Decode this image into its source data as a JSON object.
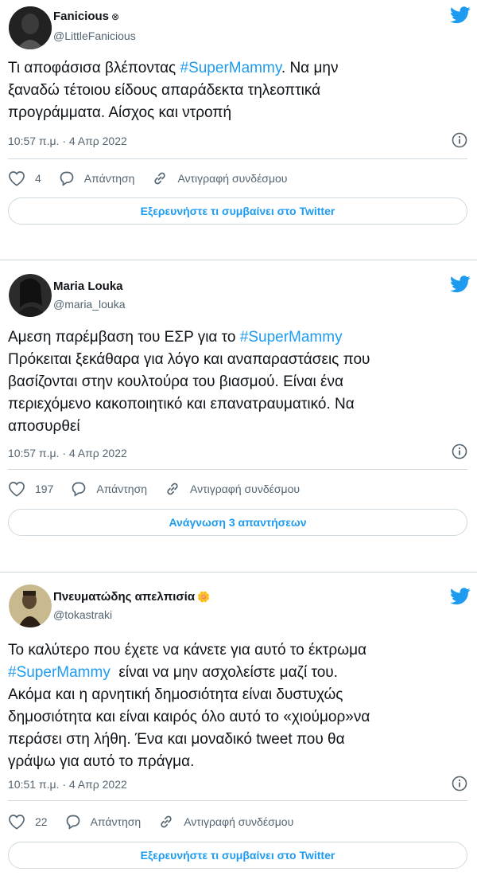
{
  "tweets": [
    {
      "name": "Fanicious",
      "name_suffix": "⊗",
      "handle": "@LittleFanicious",
      "text_lines": [
        [
          "Τι αποφάσισα βλέποντας ",
          "#SuperMammy",
          ". Να μην"
        ],
        [
          "ξαναδώ τέτοιου είδους απαράδεκτα τηλεοπτικά",
          "",
          ""
        ],
        [
          "προγράμματα. Αίσχος και ντροπή",
          "",
          ""
        ]
      ],
      "time": "10:57 π.μ. · 4 Απρ 2022",
      "likes": "4",
      "reply_label": "Απάντηση",
      "copy_link_label": "Αντιγραφή συνδέσμου",
      "cta_label": "Εξερευνήστε τι συμβαίνει στο Twitter"
    },
    {
      "name": "Maria Louka",
      "name_suffix": "",
      "handle": "@maria_louka",
      "text_lines": [
        [
          "Αμεση παρέμβαση του ΕΣΡ για το ",
          "#SuperMammy",
          ""
        ],
        [
          "Πρόκειται ξεκάθαρα για λόγο και αναπαραστάσεις που",
          "",
          ""
        ],
        [
          "βασίζονται στην κουλτούρα του βιασμού. Είναι ένα",
          "",
          ""
        ],
        [
          "περιεχόμενο κακοποιητικό και επανατραυματικό. Να",
          "",
          ""
        ],
        [
          "αποσυρθεί",
          "",
          ""
        ]
      ],
      "time": "10:57 π.μ. · 4 Απρ 2022",
      "likes": "197",
      "reply_label": "Απάντηση",
      "copy_link_label": "Αντιγραφή συνδέσμου",
      "cta_label": "Ανάγνωση 3 απαντήσεων"
    },
    {
      "name": "Πνευματώδης απελπισία",
      "name_suffix": "🌼",
      "handle": "@tokastraki",
      "text_lines": [
        [
          "Το καλύτερο που έχετε να κάνετε για αυτό το έκτρωμα",
          "",
          ""
        ],
        [
          "",
          "#SuperMammy",
          "  είναι να μην ασχολείστε μαζί του."
        ],
        [
          "Ακόμα και η αρνητική δημοσιότητα είναι δυστυχώς",
          "",
          ""
        ],
        [
          "δημοσιότητα και είναι καιρός όλο αυτό το «χιούμορ»να",
          "",
          ""
        ],
        [
          "περάσει στη λήθη. Ένα και μοναδικό tweet που θα",
          "",
          ""
        ],
        [
          "γράψω για αυτό το πράγμα.",
          "",
          ""
        ]
      ],
      "time": "10:51 π.μ. · 4 Απρ 2022",
      "likes": "22",
      "reply_label": "Απάντηση",
      "copy_link_label": "Αντιγραφή συνδέσμου",
      "cta_label": "Εξερευνήστε τι συμβαίνει στο Twitter"
    }
  ],
  "colors": {
    "accent": "#1d9bf0",
    "secondary_text": "#536471",
    "border": "#cfd9de"
  },
  "icons": [
    "twitter-bird-icon",
    "info-icon",
    "heart-icon",
    "reply-bubble-icon",
    "link-icon"
  ]
}
